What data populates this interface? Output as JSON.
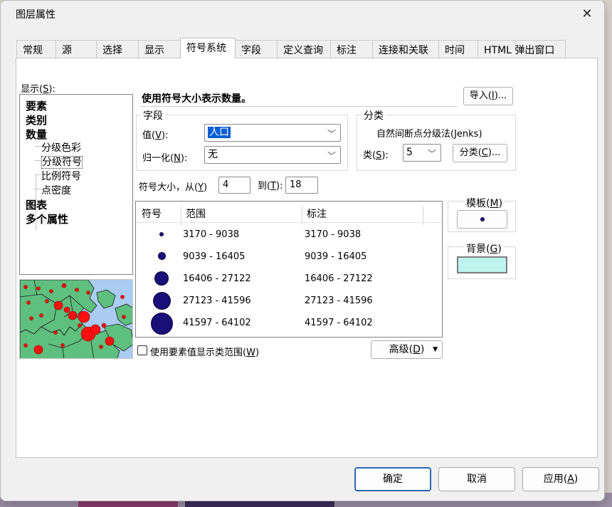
{
  "window": {
    "title": "图层属性",
    "close_icon": "close-icon"
  },
  "tabs": [
    {
      "label": "常规"
    },
    {
      "label": "源"
    },
    {
      "label": "选择"
    },
    {
      "label": "显示"
    },
    {
      "label": "符号系统",
      "active": true
    },
    {
      "label": "字段"
    },
    {
      "label": "定义查询"
    },
    {
      "label": "标注"
    },
    {
      "label": "连接和关联"
    },
    {
      "label": "时间"
    },
    {
      "label": "HTML 弹出窗口"
    }
  ],
  "show": {
    "label": "显示(",
    "key": "S",
    "label_end": "):",
    "items": [
      {
        "label": "要素",
        "level": 0
      },
      {
        "label": "类别",
        "level": 0
      },
      {
        "label": "数量",
        "level": 0
      },
      {
        "label": "分级色彩",
        "level": 1
      },
      {
        "label": "分级符号",
        "level": 1,
        "selected": true
      },
      {
        "label": "比例符号",
        "level": 1
      },
      {
        "label": "点密度",
        "level": 1
      },
      {
        "label": "图表",
        "level": 0
      },
      {
        "label": "多个属性",
        "level": 0
      }
    ]
  },
  "description": "使用符号大小表示数量。",
  "import_button": {
    "label": "导入(",
    "key": "I",
    "end": ")..."
  },
  "fields": {
    "group_title": "字段",
    "value_label": "值(",
    "value_key": "V",
    "value_end": "):",
    "value_selected": "人口",
    "normalize_label": "归一化(",
    "normalize_key": "N",
    "normalize_end": "):",
    "normalize_selected": "无"
  },
  "classification": {
    "group_title": "分类",
    "method": "自然间断点分级法(Jenks)",
    "classes_label": "类(",
    "classes_key": "S",
    "classes_end": "):",
    "classes_value": "5",
    "classify_button": "分类(",
    "classify_key": "C",
    "classify_end": ")..."
  },
  "symbol_size": {
    "from_label": "符号大小，从(",
    "from_key": "Y",
    "from_end": ")",
    "from_value": "4",
    "to_label": "到(",
    "to_key": "T",
    "to_end": "):",
    "to_value": "18"
  },
  "symbol_table": {
    "headers": [
      "符号",
      "范围",
      "标注"
    ],
    "rows": [
      {
        "range": "3170 - 9038",
        "label": "3170 - 9038"
      },
      {
        "range": "9039 - 16405",
        "label": "9039 - 16405"
      },
      {
        "range": "16406 - 27122",
        "label": "16406 - 27122"
      },
      {
        "range": "27123 - 41596",
        "label": "27123 - 41596"
      },
      {
        "range": "41597 - 64102",
        "label": "41597 - 64102"
      }
    ],
    "symbol_color": "#1a0f78"
  },
  "template": {
    "label": "模板(",
    "key": "M",
    "end": ")"
  },
  "background": {
    "label": "背景(",
    "key": "G",
    "end": ")",
    "color": "#bff3ee"
  },
  "use_feature_values": {
    "label": "使用要素值显示类范围(",
    "key": "W",
    "end": ")",
    "checked": false
  },
  "advanced_button": {
    "label": "高级(",
    "key": "D",
    "end": ")"
  },
  "footer": {
    "ok": "确定",
    "cancel": "取消",
    "apply": "应用(",
    "apply_key": "A",
    "apply_end": ")"
  }
}
